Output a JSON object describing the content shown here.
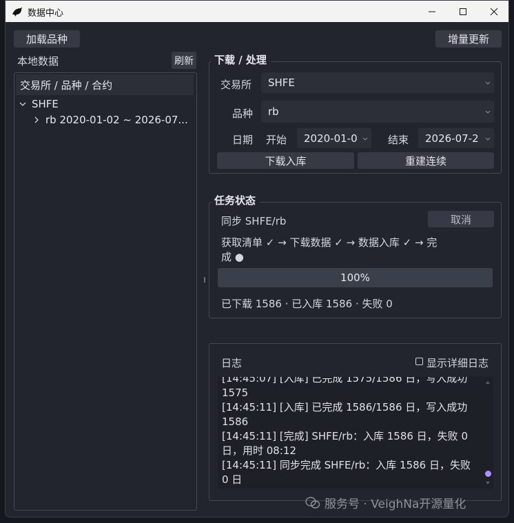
{
  "window": {
    "title": "数据中心"
  },
  "toolbar": {
    "load_symbols": "加载品种",
    "incremental_update": "增量更新"
  },
  "local_data": {
    "title": "本地数据",
    "refresh": "刷新",
    "tree_header": "交易所 / 品种 / 合约",
    "exchange": "SHFE",
    "symbol_row": "rb  2020-01-02 ~ 2026-07..."
  },
  "download": {
    "group_title": "下载 / 处理",
    "exchange_label": "交易所",
    "exchange_value": "SHFE",
    "symbol_label": "品种",
    "symbol_value": "rb",
    "date_label": "日期",
    "start_label": "开始",
    "start_value": "2020-01-0",
    "end_label": "结束",
    "end_value": "2026-07-2",
    "download_button": "下载入库",
    "rebuild_button": "重建连续"
  },
  "task": {
    "group_title": "任务状态",
    "sync_label": "同步 SHFE/rb",
    "cancel_button": "取消",
    "steps_line1": "获取清单 ✓  →  下载数据 ✓  →  数据入库 ✓  →  完",
    "steps_line2": "成 ●",
    "progress": 100,
    "progress_text": "100%",
    "stats": "已下载 1586 · 已入库 1586 · 失败 0"
  },
  "log": {
    "title": "日志",
    "detail_checkbox": "显示详细日志",
    "lines": [
      "[14:45:07] [入库] 已完成 1575/1586 日，写入成功",
      "1575",
      "[14:45:11] [入库] 已完成 1586/1586 日，写入成功",
      "1586",
      "[14:45:11] [完成] SHFE/rb：入库 1586 日，失败 0",
      "日，用时 08:12",
      "[14:45:11] 同步完成 SHFE/rb：入库 1586 日，失败",
      "0 日"
    ]
  },
  "watermark": {
    "text": "服务号 · VeighNa开源量化"
  }
}
